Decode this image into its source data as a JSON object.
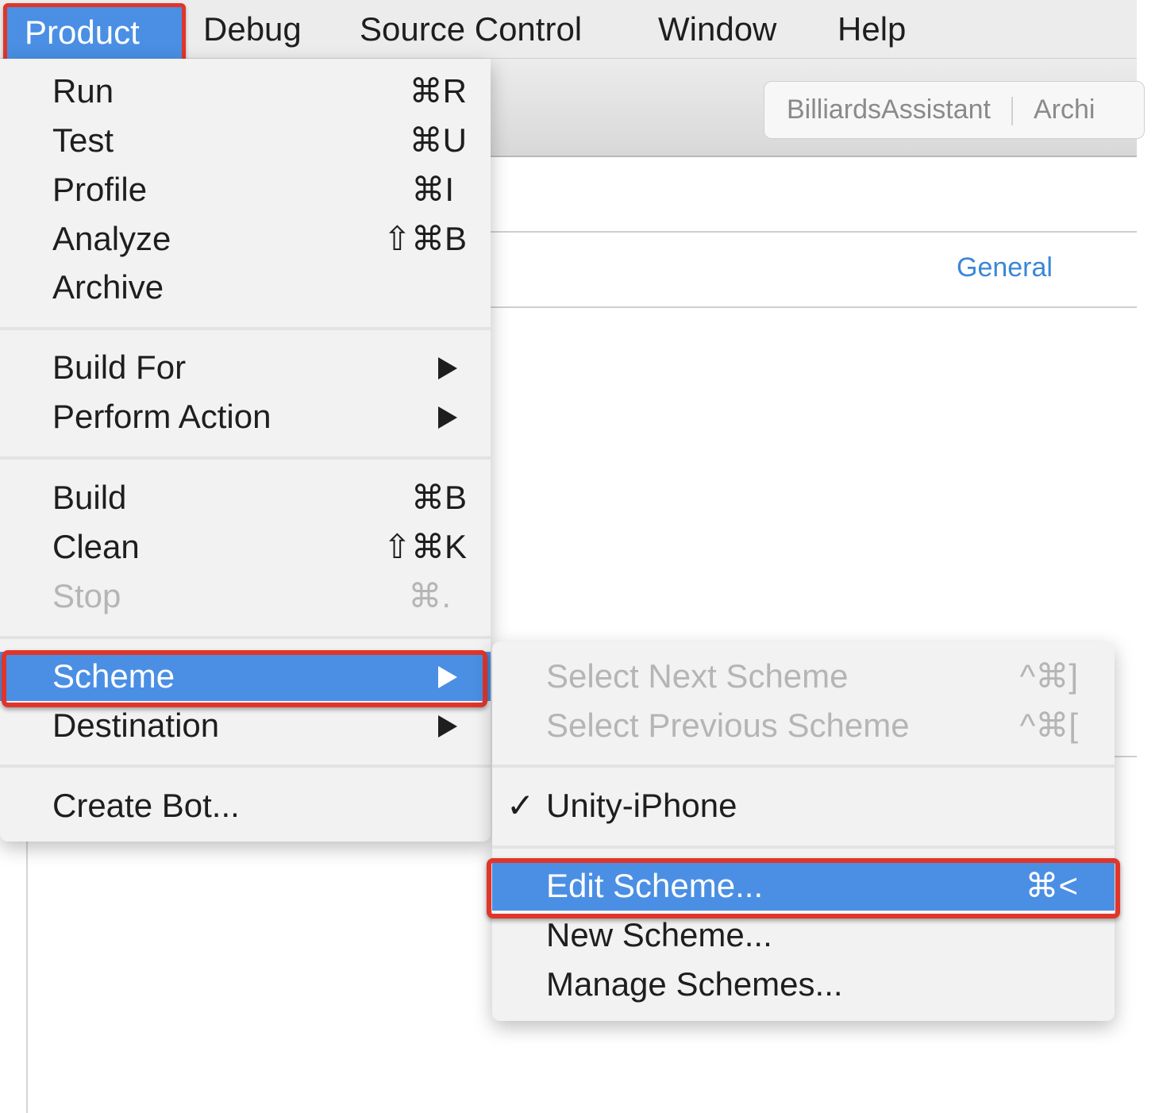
{
  "menubar": {
    "items": [
      "Product",
      "Debug",
      "Source Control",
      "Window",
      "Help"
    ]
  },
  "window": {
    "path_control": [
      "BilliardsAssistant",
      "Archi"
    ],
    "tab_general": "General"
  },
  "product_menu": {
    "items": [
      {
        "label": "Run",
        "shortcut": "⌘R"
      },
      {
        "label": "Test",
        "shortcut": "⌘U"
      },
      {
        "label": "Profile",
        "shortcut": "⌘I"
      },
      {
        "label": "Analyze",
        "shortcut": "⇧⌘B"
      },
      {
        "label": "Archive",
        "shortcut": ""
      },
      {
        "label": "Build For",
        "submenu": true
      },
      {
        "label": "Perform Action",
        "submenu": true
      },
      {
        "label": "Build",
        "shortcut": "⌘B"
      },
      {
        "label": "Clean",
        "shortcut": "⇧⌘K"
      },
      {
        "label": "Stop",
        "shortcut": "⌘.",
        "disabled": true
      },
      {
        "label": "Scheme",
        "submenu": true,
        "highlighted": true
      },
      {
        "label": "Destination",
        "submenu": true
      },
      {
        "label": "Create Bot..."
      }
    ]
  },
  "scheme_menu": {
    "items": [
      {
        "label": "Select Next Scheme",
        "shortcut": "^⌘]",
        "disabled": true
      },
      {
        "label": "Select Previous Scheme",
        "shortcut": "^⌘[",
        "disabled": true
      },
      {
        "label": "Unity-iPhone",
        "checked": true,
        "check": "✓"
      },
      {
        "label": "Edit Scheme...",
        "shortcut": "⌘<",
        "highlighted": true
      },
      {
        "label": "New Scheme..."
      },
      {
        "label": "Manage Schemes..."
      }
    ]
  },
  "colors": {
    "highlight": "#4a8fe4",
    "annotation": "#e0352b",
    "link": "#3a86d8"
  }
}
